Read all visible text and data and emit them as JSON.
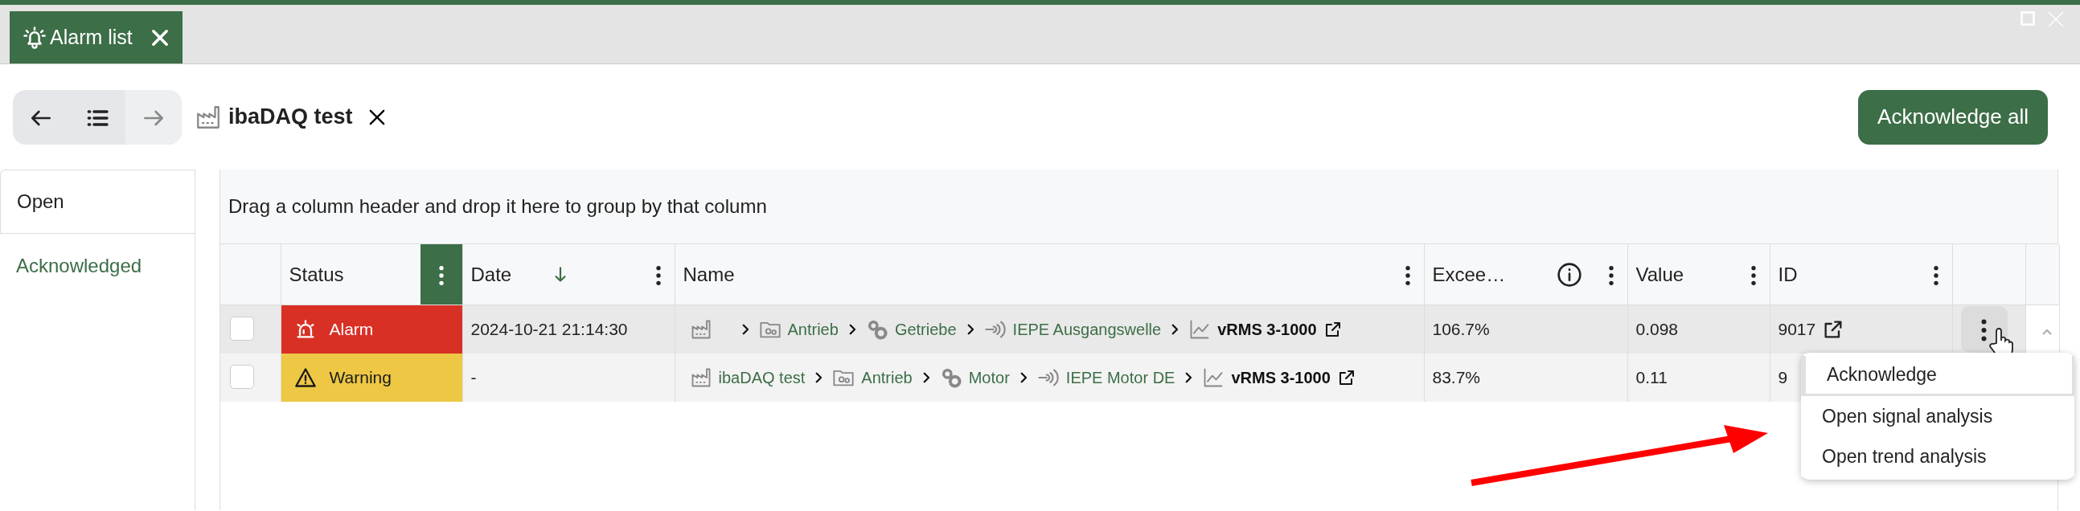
{
  "window": {
    "tab": {
      "label": "Alarm list"
    }
  },
  "toolbar": {
    "title": "ibaDAQ test",
    "forward_disabled": true,
    "primary_button": "Acknowledge all"
  },
  "side_tabs": [
    {
      "label": "Open",
      "selected": true
    },
    {
      "label": "Acknowledged",
      "selected": false
    }
  ],
  "table": {
    "group_hint": "Drag a column header and drop it here to group by that column",
    "columns": [
      {
        "label": "Status",
        "menu_highlighted": true,
        "sorted_descending": false,
        "info": false
      },
      {
        "label": "Date",
        "menu_highlighted": false,
        "sorted_descending": true,
        "info": false
      },
      {
        "label": "Name",
        "menu_highlighted": false,
        "sorted_descending": false,
        "info": false
      },
      {
        "label": "Excee…",
        "menu_highlighted": false,
        "sorted_descending": false,
        "info": true
      },
      {
        "label": "Value",
        "menu_highlighted": false,
        "sorted_descending": false,
        "info": false
      },
      {
        "label": "ID",
        "menu_highlighted": false,
        "sorted_descending": false,
        "info": false
      }
    ],
    "rows": [
      {
        "checked": false,
        "hovered": true,
        "status": {
          "kind": "alarm",
          "label": "Alarm"
        },
        "date": "2024-10-21 21:14:30",
        "path": [
          {
            "kind": "plant"
          },
          {
            "kind": "folder",
            "label": "Antrieb"
          },
          {
            "kind": "gears",
            "label": "Getriebe"
          },
          {
            "kind": "sensor",
            "label": "IEPE Ausgangswelle"
          },
          {
            "kind": "signal",
            "label": "vRMS 3-1000"
          }
        ],
        "exceeded": "106.7%",
        "value": "0.098",
        "id": "9017",
        "id_link": true
      },
      {
        "checked": false,
        "hovered": false,
        "status": {
          "kind": "warning",
          "label": "Warning"
        },
        "date": "-",
        "path": [
          {
            "kind": "plant",
            "label": "ibaDAQ test"
          },
          {
            "kind": "folder",
            "label": "Antrieb"
          },
          {
            "kind": "gears",
            "label": "Motor"
          },
          {
            "kind": "sensor",
            "label": "IEPE Motor DE"
          },
          {
            "kind": "signal",
            "label": "vRMS 3-1000"
          }
        ],
        "exceeded": "83.7%",
        "value": "0.11",
        "id": "9",
        "id_link": false
      }
    ]
  },
  "context_menu": {
    "items": [
      {
        "label": "Acknowledge",
        "selected": true
      },
      {
        "label": "Open signal analysis",
        "selected": false
      },
      {
        "label": "Open trend analysis",
        "selected": false
      }
    ]
  }
}
